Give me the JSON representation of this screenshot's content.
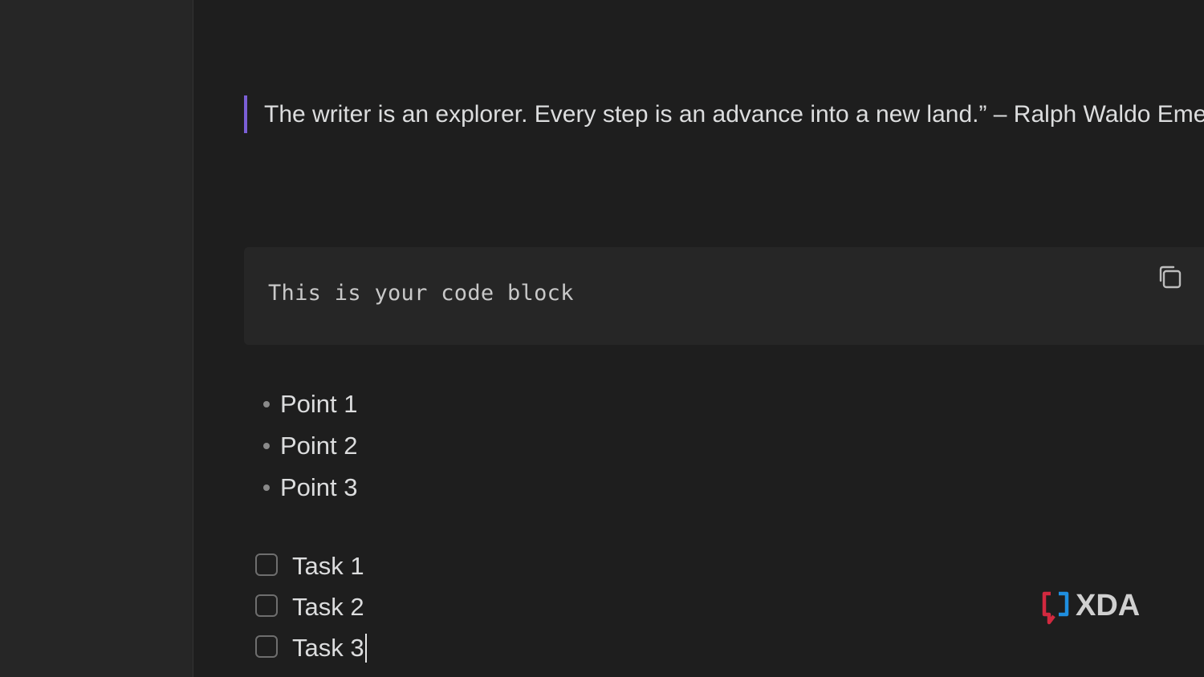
{
  "blockquote": {
    "text": "The writer is an explorer. Every step is an advance into a new land.” – Ralph Waldo Emerson"
  },
  "code_block": {
    "text": "This is your code block",
    "copy_icon": "copy-icon"
  },
  "bullets": [
    {
      "label": "Point 1"
    },
    {
      "label": "Point 2"
    },
    {
      "label": "Point 3"
    }
  ],
  "tasks": [
    {
      "label": "Task 1",
      "checked": false
    },
    {
      "label": "Task 2",
      "checked": false
    },
    {
      "label": "Task 3",
      "checked": false
    }
  ],
  "watermark": {
    "text": "XDA"
  },
  "colors": {
    "accent": "#7b5fd6",
    "background": "#1e1e1e",
    "sidebar": "#262626"
  }
}
